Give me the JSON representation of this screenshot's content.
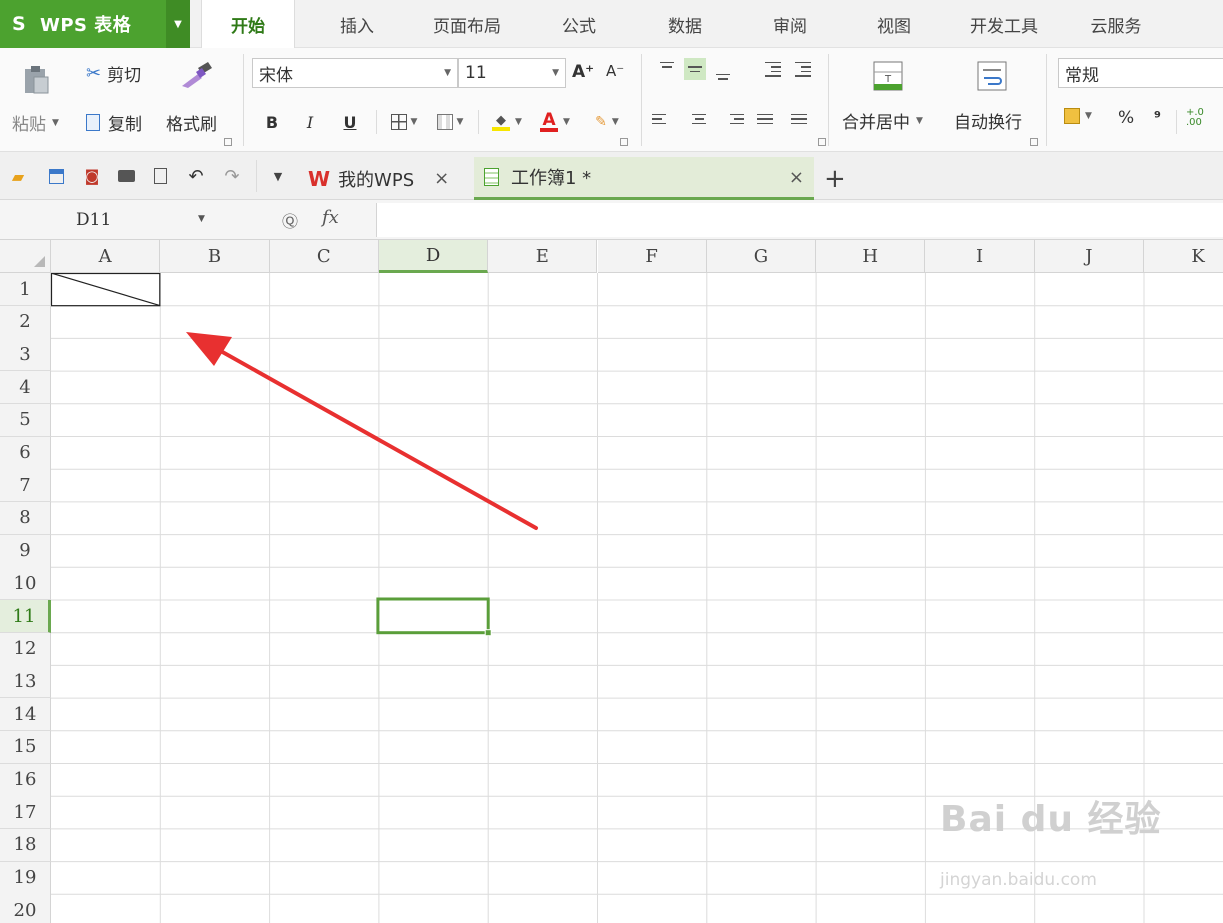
{
  "app": {
    "logo": "S",
    "title": "WPS 表格",
    "dropdown_icon": "triangle-down"
  },
  "menu_tabs": [
    "开始",
    "插入",
    "页面布局",
    "公式",
    "数据",
    "审阅",
    "视图",
    "开发工具",
    "云服务"
  ],
  "active_menu_tab": "开始",
  "ribbon": {
    "paste": "粘贴",
    "cut": "剪切",
    "copy": "复制",
    "format_painter": "格式刷",
    "font_name": "宋体",
    "font_size": "11",
    "grow_font": "A⁺",
    "shrink_font": "A⁻",
    "bold": "B",
    "italic": "I",
    "underline": "U",
    "font_color_letter": "A",
    "merge_center": "合并居中",
    "wrap_text": "自动换行",
    "number_format": "常规",
    "percent": "%",
    "comma": "⁹",
    "decimal": "+.0 .00",
    "colors": {
      "fill": "#f7e600",
      "font": "#e02020",
      "accent": "#4ca22f"
    }
  },
  "doc_tabs": [
    {
      "label": "我的WPS",
      "close": "×"
    },
    {
      "label": "工作簿1 *",
      "close": "×"
    }
  ],
  "new_tab": "+",
  "formula_bar": {
    "cell_ref": "D11",
    "zoom_icon": "Ⓠ",
    "fx": "fx",
    "value": ""
  },
  "columns": [
    "A",
    "B",
    "C",
    "D",
    "E",
    "F",
    "G",
    "H",
    "I",
    "J",
    "K"
  ],
  "rows": [
    "1",
    "2",
    "3",
    "4",
    "5",
    "6",
    "7",
    "8",
    "9",
    "10",
    "11",
    "12",
    "13",
    "14",
    "15",
    "16",
    "17",
    "18",
    "19",
    "20"
  ],
  "selected_cell": {
    "column": "D",
    "row": "11"
  },
  "diagonal_cell": {
    "column": "A",
    "row": "1"
  },
  "annotation_color": "#e83030",
  "watermark": {
    "main": "Bai du 经验",
    "sub": "jingyan.baidu.com"
  }
}
